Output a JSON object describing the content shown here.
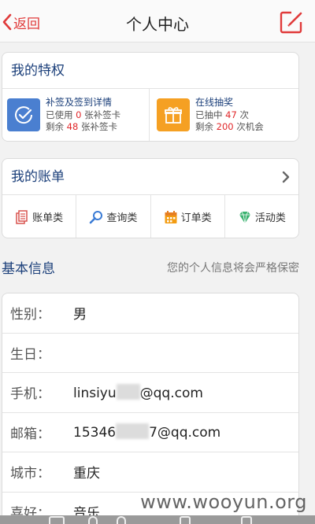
{
  "header": {
    "back_label": "返回",
    "title": "个人中心"
  },
  "privileges": {
    "title": "我的特权",
    "items": [
      {
        "title": "补签及签到详情",
        "line1_prefix": "已使用 ",
        "line1_value": "0",
        "line1_suffix": " 张补签卡",
        "line2_prefix": "剩余 ",
        "line2_value": "48",
        "line2_suffix": " 张补签卡",
        "icon": "check-circle-icon",
        "icon_color": "#4a7fd0"
      },
      {
        "title": "在线抽奖",
        "line1_prefix": "已抽中 ",
        "line1_value": "47",
        "line1_suffix": " 次",
        "line2_prefix": "剩余 ",
        "line2_value": "200",
        "line2_suffix": " 次机会",
        "icon": "gift-icon",
        "icon_color": "#f5a023"
      }
    ]
  },
  "bills": {
    "title": "我的账单",
    "items": [
      {
        "label": "账单类",
        "icon": "bills-icon"
      },
      {
        "label": "查询类",
        "icon": "search-icon"
      },
      {
        "label": "订单类",
        "icon": "calendar-icon"
      },
      {
        "label": "活动类",
        "icon": "gem-icon"
      }
    ]
  },
  "basic_info": {
    "title": "基本信息",
    "note": "您的个人信息将会严格保密",
    "rows": [
      {
        "label": "性别：",
        "value": "男"
      },
      {
        "label": "生日：",
        "value": ""
      },
      {
        "label": "手机：",
        "value_prefix": "linsiyu",
        "value_suffix": "@qq.com"
      },
      {
        "label": "邮箱：",
        "value_prefix": "15346",
        "value_suffix": "7@qq.com"
      },
      {
        "label": "城市：",
        "value": "重庆"
      },
      {
        "label": "喜好：",
        "value": "音乐"
      }
    ]
  },
  "watermark": "www.wooyun.org",
  "colors": {
    "accent_red": "#e03a3a",
    "title_blue": "#1b3f7a"
  }
}
